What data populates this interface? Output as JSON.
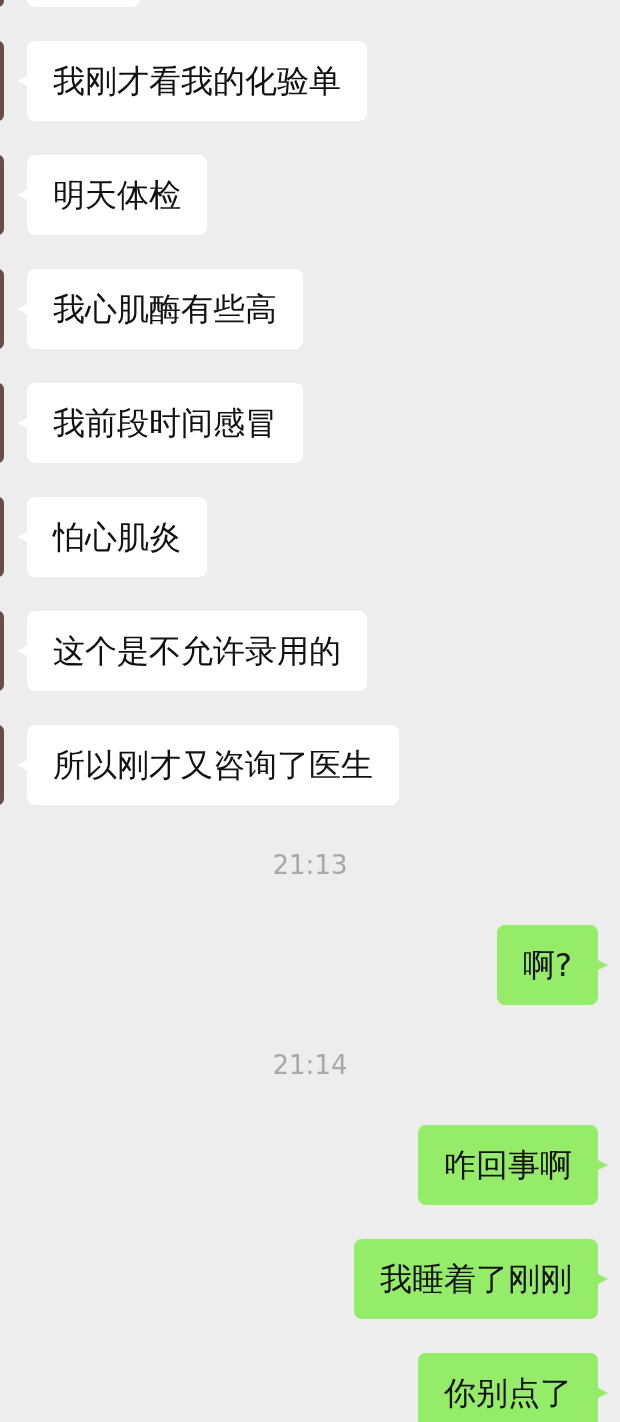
{
  "messages": [
    {
      "kind": "received",
      "text": "我刚才看我的化验单"
    },
    {
      "kind": "received",
      "text": "明天体检"
    },
    {
      "kind": "received",
      "text": "我心肌酶有些高"
    },
    {
      "kind": "received",
      "text": "我前段时间感冒"
    },
    {
      "kind": "received",
      "text": "怕心肌炎"
    },
    {
      "kind": "received",
      "text": "这个是不允许录用的"
    },
    {
      "kind": "received",
      "text": "所以刚才又咨询了医生"
    },
    {
      "kind": "time",
      "text": "21:13"
    },
    {
      "kind": "sent",
      "text": "啊?"
    },
    {
      "kind": "time",
      "text": "21:14"
    },
    {
      "kind": "sent",
      "text": "咋回事啊"
    },
    {
      "kind": "sent",
      "text": "我睡着了刚刚"
    },
    {
      "kind": "sent",
      "text": "你别点了"
    }
  ]
}
